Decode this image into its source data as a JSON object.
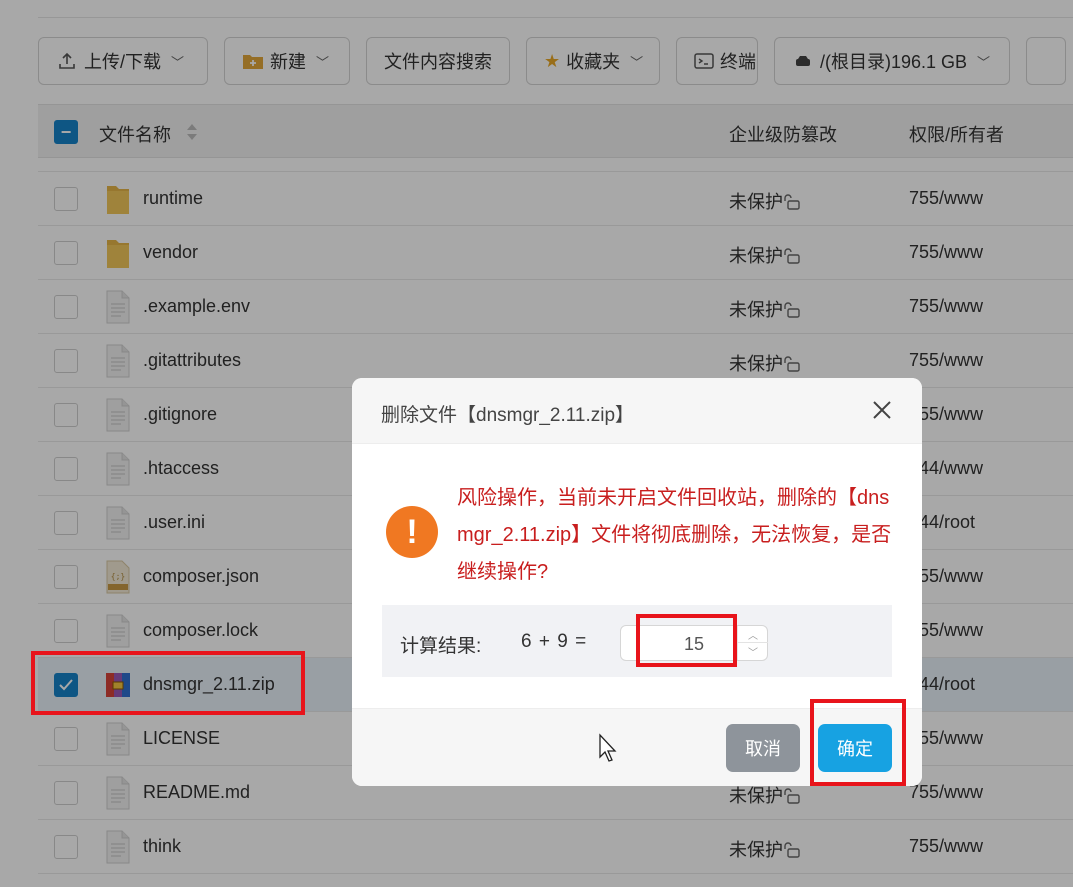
{
  "toolbar": {
    "upload": "上传/下载",
    "new": "新建",
    "search": "文件内容搜索",
    "favorites": "收藏夹",
    "terminal": "终端",
    "path": "/(根目录)196.1 GB"
  },
  "table": {
    "col_name": "文件名称",
    "col_protect": "企业级防篡改",
    "col_perm": "权限/所有者"
  },
  "rows": [
    {
      "name": "runtime",
      "protect": "未保护",
      "perm": "755/www",
      "type": "folder"
    },
    {
      "name": "vendor",
      "protect": "未保护",
      "perm": "755/www",
      "type": "folder"
    },
    {
      "name": ".example.env",
      "protect": "未保护",
      "perm": "755/www",
      "type": "file"
    },
    {
      "name": ".gitattributes",
      "protect": "未保护",
      "perm": "755/www",
      "type": "file"
    },
    {
      "name": ".gitignore",
      "protect": "",
      "perm": "755/www",
      "type": "file"
    },
    {
      "name": ".htaccess",
      "protect": "",
      "perm": "644/www",
      "type": "file"
    },
    {
      "name": ".user.ini",
      "protect": "",
      "perm": "644/root",
      "type": "file"
    },
    {
      "name": "composer.json",
      "protect": "",
      "perm": "755/www",
      "type": "json"
    },
    {
      "name": "composer.lock",
      "protect": "",
      "perm": "755/www",
      "type": "file"
    },
    {
      "name": "dnsmgr_2.11.zip",
      "protect": "",
      "perm": "644/root",
      "type": "zip",
      "selected": true
    },
    {
      "name": "LICENSE",
      "protect": "",
      "perm": "755/www",
      "type": "file"
    },
    {
      "name": "README.md",
      "protect": "未保护",
      "perm": "755/www",
      "type": "file"
    },
    {
      "name": "think",
      "protect": "未保护",
      "perm": "755/www",
      "type": "file"
    }
  ],
  "dialog": {
    "title": "删除文件【dnsmgr_2.11.zip】",
    "warning": "风险操作，当前未开启文件回收站，删除的【dnsmgr_2.11.zip】文件将彻底删除，无法恢复，是否继续操作?",
    "calc_label": "计算结果:",
    "calc_expr": "6 + 9  =",
    "calc_value": "15",
    "cancel": "取消",
    "confirm": "确定"
  },
  "colors": {
    "accent": "#17a2e2",
    "warning_text": "#c81e1e",
    "warning_icon": "#f07822",
    "highlight": "#e8141b"
  }
}
